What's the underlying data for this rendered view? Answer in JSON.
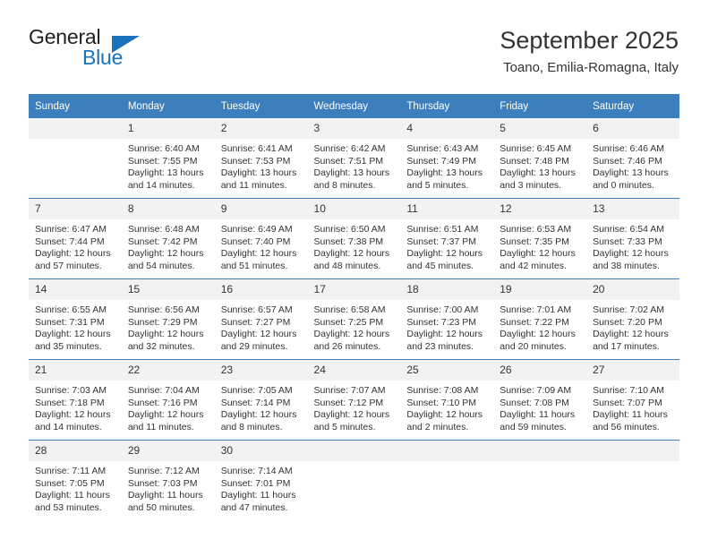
{
  "brand": {
    "name_top": "General",
    "name_bottom": "Blue",
    "accent_color": "#1b72bb"
  },
  "header": {
    "title": "September 2025",
    "subtitle": "Toano, Emilia-Romagna, Italy"
  },
  "calendar": {
    "header_bg": "#3d7ebc",
    "daynum_bg": "#f2f2f2",
    "weekday_headers": [
      "Sunday",
      "Monday",
      "Tuesday",
      "Wednesday",
      "Thursday",
      "Friday",
      "Saturday"
    ],
    "weeks": [
      [
        {
          "day": "",
          "lines": []
        },
        {
          "day": "1",
          "lines": [
            "Sunrise: 6:40 AM",
            "Sunset: 7:55 PM",
            "Daylight: 13 hours",
            "and 14 minutes."
          ]
        },
        {
          "day": "2",
          "lines": [
            "Sunrise: 6:41 AM",
            "Sunset: 7:53 PM",
            "Daylight: 13 hours",
            "and 11 minutes."
          ]
        },
        {
          "day": "3",
          "lines": [
            "Sunrise: 6:42 AM",
            "Sunset: 7:51 PM",
            "Daylight: 13 hours",
            "and 8 minutes."
          ]
        },
        {
          "day": "4",
          "lines": [
            "Sunrise: 6:43 AM",
            "Sunset: 7:49 PM",
            "Daylight: 13 hours",
            "and 5 minutes."
          ]
        },
        {
          "day": "5",
          "lines": [
            "Sunrise: 6:45 AM",
            "Sunset: 7:48 PM",
            "Daylight: 13 hours",
            "and 3 minutes."
          ]
        },
        {
          "day": "6",
          "lines": [
            "Sunrise: 6:46 AM",
            "Sunset: 7:46 PM",
            "Daylight: 13 hours",
            "and 0 minutes."
          ]
        }
      ],
      [
        {
          "day": "7",
          "lines": [
            "Sunrise: 6:47 AM",
            "Sunset: 7:44 PM",
            "Daylight: 12 hours",
            "and 57 minutes."
          ]
        },
        {
          "day": "8",
          "lines": [
            "Sunrise: 6:48 AM",
            "Sunset: 7:42 PM",
            "Daylight: 12 hours",
            "and 54 minutes."
          ]
        },
        {
          "day": "9",
          "lines": [
            "Sunrise: 6:49 AM",
            "Sunset: 7:40 PM",
            "Daylight: 12 hours",
            "and 51 minutes."
          ]
        },
        {
          "day": "10",
          "lines": [
            "Sunrise: 6:50 AM",
            "Sunset: 7:38 PM",
            "Daylight: 12 hours",
            "and 48 minutes."
          ]
        },
        {
          "day": "11",
          "lines": [
            "Sunrise: 6:51 AM",
            "Sunset: 7:37 PM",
            "Daylight: 12 hours",
            "and 45 minutes."
          ]
        },
        {
          "day": "12",
          "lines": [
            "Sunrise: 6:53 AM",
            "Sunset: 7:35 PM",
            "Daylight: 12 hours",
            "and 42 minutes."
          ]
        },
        {
          "day": "13",
          "lines": [
            "Sunrise: 6:54 AM",
            "Sunset: 7:33 PM",
            "Daylight: 12 hours",
            "and 38 minutes."
          ]
        }
      ],
      [
        {
          "day": "14",
          "lines": [
            "Sunrise: 6:55 AM",
            "Sunset: 7:31 PM",
            "Daylight: 12 hours",
            "and 35 minutes."
          ]
        },
        {
          "day": "15",
          "lines": [
            "Sunrise: 6:56 AM",
            "Sunset: 7:29 PM",
            "Daylight: 12 hours",
            "and 32 minutes."
          ]
        },
        {
          "day": "16",
          "lines": [
            "Sunrise: 6:57 AM",
            "Sunset: 7:27 PM",
            "Daylight: 12 hours",
            "and 29 minutes."
          ]
        },
        {
          "day": "17",
          "lines": [
            "Sunrise: 6:58 AM",
            "Sunset: 7:25 PM",
            "Daylight: 12 hours",
            "and 26 minutes."
          ]
        },
        {
          "day": "18",
          "lines": [
            "Sunrise: 7:00 AM",
            "Sunset: 7:23 PM",
            "Daylight: 12 hours",
            "and 23 minutes."
          ]
        },
        {
          "day": "19",
          "lines": [
            "Sunrise: 7:01 AM",
            "Sunset: 7:22 PM",
            "Daylight: 12 hours",
            "and 20 minutes."
          ]
        },
        {
          "day": "20",
          "lines": [
            "Sunrise: 7:02 AM",
            "Sunset: 7:20 PM",
            "Daylight: 12 hours",
            "and 17 minutes."
          ]
        }
      ],
      [
        {
          "day": "21",
          "lines": [
            "Sunrise: 7:03 AM",
            "Sunset: 7:18 PM",
            "Daylight: 12 hours",
            "and 14 minutes."
          ]
        },
        {
          "day": "22",
          "lines": [
            "Sunrise: 7:04 AM",
            "Sunset: 7:16 PM",
            "Daylight: 12 hours",
            "and 11 minutes."
          ]
        },
        {
          "day": "23",
          "lines": [
            "Sunrise: 7:05 AM",
            "Sunset: 7:14 PM",
            "Daylight: 12 hours",
            "and 8 minutes."
          ]
        },
        {
          "day": "24",
          "lines": [
            "Sunrise: 7:07 AM",
            "Sunset: 7:12 PM",
            "Daylight: 12 hours",
            "and 5 minutes."
          ]
        },
        {
          "day": "25",
          "lines": [
            "Sunrise: 7:08 AM",
            "Sunset: 7:10 PM",
            "Daylight: 12 hours",
            "and 2 minutes."
          ]
        },
        {
          "day": "26",
          "lines": [
            "Sunrise: 7:09 AM",
            "Sunset: 7:08 PM",
            "Daylight: 11 hours",
            "and 59 minutes."
          ]
        },
        {
          "day": "27",
          "lines": [
            "Sunrise: 7:10 AM",
            "Sunset: 7:07 PM",
            "Daylight: 11 hours",
            "and 56 minutes."
          ]
        }
      ],
      [
        {
          "day": "28",
          "lines": [
            "Sunrise: 7:11 AM",
            "Sunset: 7:05 PM",
            "Daylight: 11 hours",
            "and 53 minutes."
          ]
        },
        {
          "day": "29",
          "lines": [
            "Sunrise: 7:12 AM",
            "Sunset: 7:03 PM",
            "Daylight: 11 hours",
            "and 50 minutes."
          ]
        },
        {
          "day": "30",
          "lines": [
            "Sunrise: 7:14 AM",
            "Sunset: 7:01 PM",
            "Daylight: 11 hours",
            "and 47 minutes."
          ]
        },
        {
          "day": "",
          "lines": []
        },
        {
          "day": "",
          "lines": []
        },
        {
          "day": "",
          "lines": []
        },
        {
          "day": "",
          "lines": []
        }
      ]
    ]
  }
}
